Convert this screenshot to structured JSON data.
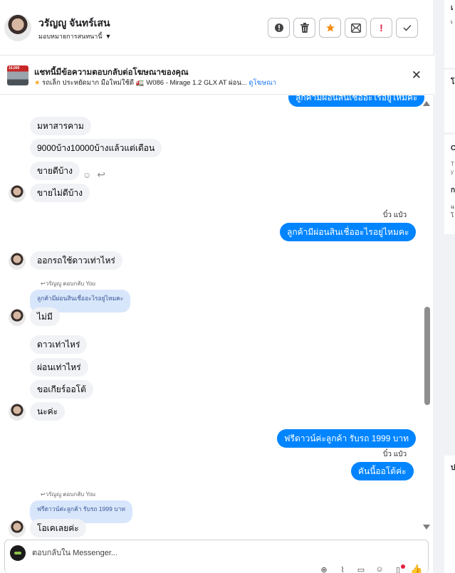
{
  "header": {
    "contact_name": "วรัญญู จันทร์เสน",
    "assign_label": "มอบหมายการสนทนานี้",
    "actions": [
      {
        "icon": "alert-circle-icon"
      },
      {
        "icon": "trash-icon"
      },
      {
        "icon": "star-icon"
      },
      {
        "icon": "mark-unread-icon"
      },
      {
        "icon": "exclamation-icon"
      },
      {
        "icon": "check-icon"
      }
    ],
    "star_color": "#f28c0f",
    "exclamation_color": "#e41e3f"
  },
  "ad_banner": {
    "thumb_text": "10,000",
    "title": "แชทนี้มีข้อความตอบกลับต่อโฆษณาของคุณ",
    "subtitle": "รถเล็ก ประหยัดมาก มือใหม่ใช้ดี",
    "subtitle_item": "W086 - Mirage 1.2 GLX AT ผ่อน...",
    "link": "ดูโฆษณา"
  },
  "chat": {
    "top_partial": "ลูกค้ามีผ่อนสินเชื่ออะไรอยู่ไหมคะ",
    "messages_in_1": [
      "มหาสารคาม",
      "9000บ้าง10000บ้างแล้วแต่เดือน",
      "ขายดีบ้าง",
      "ขายไม่ดีบ้าง"
    ],
    "sender_1": "บิ๋ว แป๋ว",
    "out_1": "ลูกค้ามีผ่อนสินเชื่ออะไรอยู่ไหมคะ",
    "in_2": "ออกรถใช้ดาวเท่าไหร่",
    "reply_label_1": "วรัญญู ตอบกลับ You",
    "quote_1": "ลูกค้ามีผ่อนสินเชื่ออะไรอยู่ไหมคะ",
    "in_3": "ไม่มี",
    "messages_in_4": [
      "ดาวเท่าไหร่",
      "ผ่อนเท่าไหร่",
      "ขอเกียร์ออโต้",
      "นะค่ะ"
    ],
    "out_2": "ฟรีดาวน์ค่ะลูกค้า  รับรถ 1999 บาท",
    "sender_2": "บิ๋ว แป๋ว",
    "out_3": "คันนี้ออโต้ค่ะ",
    "reply_label_2": "วรัญญู ตอบกลับ You",
    "quote_2": "ฟรีดาวน์ค่ะลูกค้า รับรถ 1999 บาท",
    "in_5": "โอเคเลยค่ะ",
    "bubble_out_color": "#0084ff",
    "bubble_in_color": "#f0f2f5"
  },
  "composer": {
    "placeholder": "ตอบกลับใน Messenger...",
    "tools": [
      "add-contact-icon",
      "attachment-icon",
      "saved-replies-icon",
      "emoji-icon",
      "document-icon",
      "like-icon"
    ]
  },
  "right_panel": {
    "fragments": [
      "เ",
      "เ",
      "โ",
      "C",
      "T",
      "y",
      "ก",
      "แ",
      "โ",
      "ป"
    ]
  }
}
